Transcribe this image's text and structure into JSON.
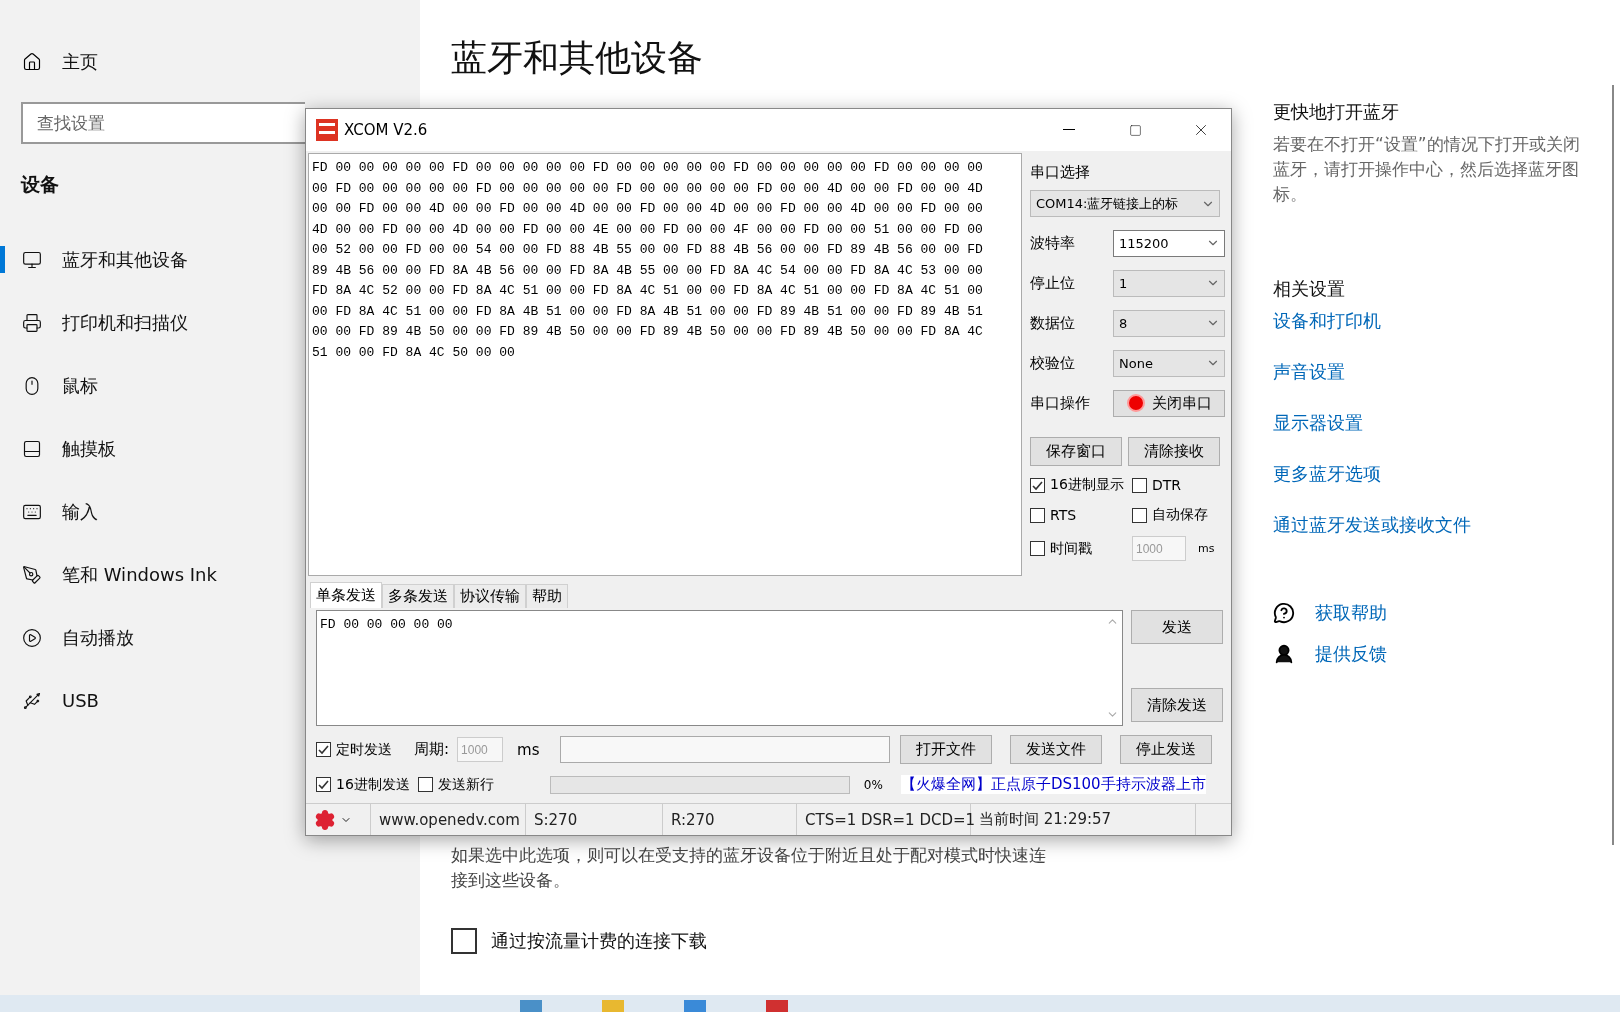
{
  "sidebar": {
    "home": "主页",
    "search": {
      "placeholder": "查找设置"
    },
    "section": "设备",
    "items": [
      {
        "label": "蓝牙和其他设备",
        "selected": true
      },
      {
        "label": "打印机和扫描仪",
        "selected": false
      },
      {
        "label": "鼠标",
        "selected": false
      },
      {
        "label": "触摸板",
        "selected": false
      },
      {
        "label": "输入",
        "selected": false
      },
      {
        "label": "笔和 Windows Ink",
        "selected": false
      },
      {
        "label": "自动播放",
        "selected": false
      },
      {
        "label": "USB",
        "selected": false
      }
    ]
  },
  "page": {
    "title": "蓝牙和其他设备",
    "description": "如果选中此选项，则可以在受支持的蓝牙设备位于附近且处于配对模式时快速连接到这些设备。",
    "metered": {
      "label": "通过按流量计费的连接下载",
      "checked": false
    }
  },
  "aside": {
    "quick_title": "更快地打开蓝牙",
    "quick_text": "若要在不打开“设置”的情况下打开或关闭蓝牙，请打开操作中心，然后选择蓝牙图标。",
    "related_title": "相关设置",
    "links": [
      "设备和打印机",
      "声音设置",
      "显示器设置",
      "更多蓝牙选项",
      "通过蓝牙发送或接收文件"
    ],
    "help": [
      {
        "kind": "help",
        "label": "获取帮助"
      },
      {
        "kind": "feedback",
        "label": "提供反馈"
      }
    ]
  },
  "xcom": {
    "title": "XCOM V2.6",
    "received": [
      "FD 00 00 00 00 00 FD 00 00 00 00 00 FD 00 00 00 00 00 FD 00 00 00 00 00 FD 00 00 00 00",
      "00 FD 00 00 00 00 00 FD 00 00 00 00 00 FD 00 00 00 00 00 FD 00 00 4D 00 00 FD 00 00 4D",
      "00 00 FD 00 00 4D 00 00 FD 00 00 4D 00 00 FD 00 00 4D 00 00 FD 00 00 4D 00 00 FD 00 00",
      "4D 00 00 FD 00 00 4D 00 00 FD 00 00 4E 00 00 FD 00 00 4F 00 00 FD 00 00 51 00 00 FD 00",
      "00 52 00 00 FD 00 00 54 00 00 FD 88 4B 55 00 00 FD 88 4B 56 00 00 FD 89 4B 56 00 00 FD",
      "89 4B 56 00 00 FD 8A 4B 56 00 00 FD 8A 4B 55 00 00 FD 8A 4C 54 00 00 FD 8A 4C 53 00 00",
      "FD 8A 4C 52 00 00 FD 8A 4C 51 00 00 FD 8A 4C 51 00 00 FD 8A 4C 51 00 00 FD 8A 4C 51 00",
      "00 FD 8A 4C 51 00 00 FD 8A 4B 51 00 00 FD 8A 4B 51 00 00 FD 89 4B 51 00 00 FD 89 4B 51",
      "00 00 FD 89 4B 50 00 00 FD 89 4B 50 00 00 FD 89 4B 50 00 00 FD 89 4B 50 00 00 FD 8A 4C",
      "51 00 00 FD 8A 4C 50 00 00"
    ],
    "port_label": "串口选择",
    "port": "COM14:蓝牙链接上的标",
    "settings": [
      {
        "label": "波特率",
        "value": "115200",
        "editable": true
      },
      {
        "label": "停止位",
        "value": "1",
        "editable": false
      },
      {
        "label": "数据位",
        "value": "8",
        "editable": false
      },
      {
        "label": "校验位",
        "value": "None",
        "editable": false
      }
    ],
    "port_action_label": "串口操作",
    "port_button": {
      "label": "关闭串口",
      "open": true
    },
    "receive_buttons": [
      "保存窗口",
      "清除接收"
    ],
    "options": [
      {
        "label": "16进制显示",
        "checked": true
      },
      {
        "label": "DTR",
        "checked": false
      },
      {
        "label": "RTS",
        "checked": false
      },
      {
        "label": "自动保存",
        "checked": false
      },
      {
        "label": "时间戳",
        "checked": false
      }
    ],
    "timestamp_interval": "1000",
    "timestamp_unit": "ms",
    "tabs": [
      {
        "label": "单条发送",
        "selected": true
      },
      {
        "label": "多条发送",
        "selected": false
      },
      {
        "label": "协议传输",
        "selected": false
      },
      {
        "label": "帮助",
        "selected": false
      }
    ],
    "send_text": "FD 00 00 00 00 00",
    "send_buttons": [
      "发送",
      "清除发送"
    ],
    "timed": {
      "label": "定时发送",
      "checked": true
    },
    "period_label": "周期:",
    "period": "1000",
    "period_unit": "ms",
    "file_buttons": [
      "打开文件",
      "发送文件",
      "停止发送"
    ],
    "hex_send": {
      "label": "16进制发送",
      "checked": true
    },
    "newline": {
      "label": "发送新行",
      "checked": false
    },
    "progress": {
      "level": 0,
      "reading": "0%"
    },
    "ad": "【火爆全网】正点原子DS100手持示波器上市",
    "status": [
      "www.openedv.com",
      "S:270",
      "R:270",
      "CTS=1 DSR=1 DCD=1",
      "当前时间 21:29:57"
    ]
  }
}
